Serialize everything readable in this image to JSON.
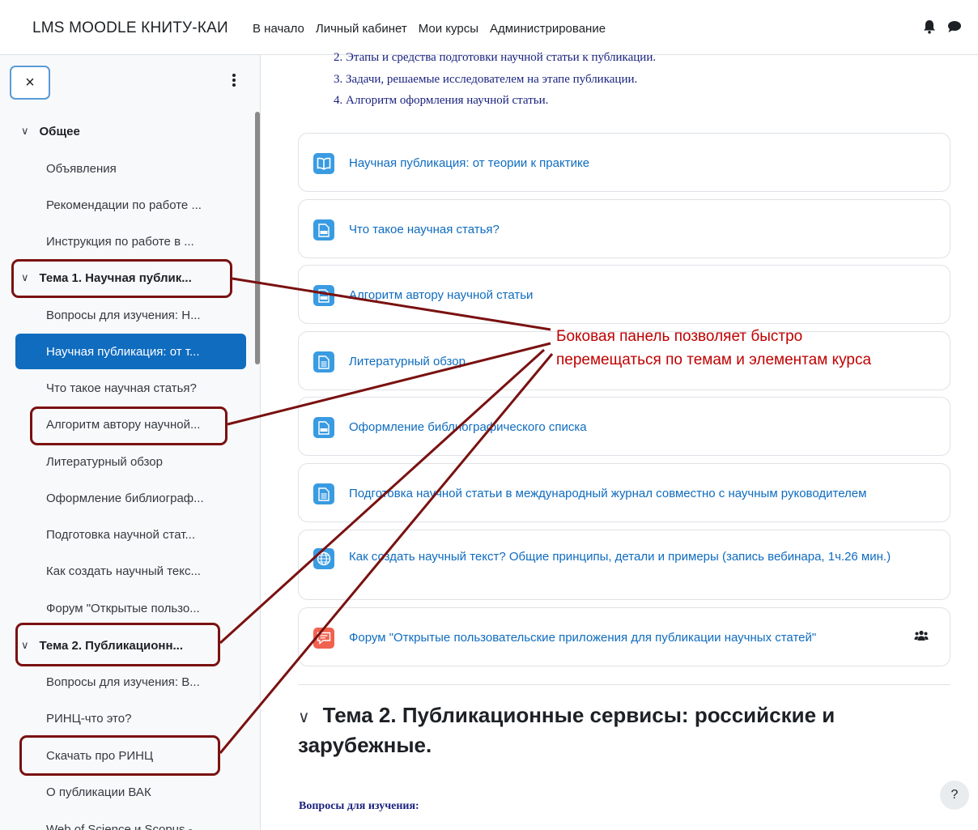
{
  "navbar": {
    "brand": "LMS MOODLE КНИТУ-КАИ",
    "links": [
      "В начало",
      "Личный кабинет",
      "Мои курсы",
      "Администрирование"
    ]
  },
  "sidebar": {
    "close_label": "×",
    "items": [
      {
        "label": "Общее",
        "type": "section"
      },
      {
        "label": "Объявления",
        "type": "activity"
      },
      {
        "label": "Рекомендации по работе ...",
        "type": "activity"
      },
      {
        "label": "Инструкция по работе в ...",
        "type": "activity"
      },
      {
        "label": "Тема 1. Научная публик...",
        "type": "section"
      },
      {
        "label": "Вопросы для изучения:  Н...",
        "type": "activity"
      },
      {
        "label": "Научная публикация: от т...",
        "type": "activity",
        "active": true
      },
      {
        "label": "Что такое научная статья?",
        "type": "activity"
      },
      {
        "label": "Алгоритм автору научной...",
        "type": "activity"
      },
      {
        "label": "Литературный обзор",
        "type": "activity"
      },
      {
        "label": "Оформление библиограф...",
        "type": "activity"
      },
      {
        "label": "Подготовка научной стат...",
        "type": "activity"
      },
      {
        "label": "Как создать научный текс...",
        "type": "activity"
      },
      {
        "label": "Форум \"Открытые пользо...",
        "type": "activity"
      },
      {
        "label": "Тема 2. Публикационн...",
        "type": "section"
      },
      {
        "label": "Вопросы для изучения: В...",
        "type": "activity"
      },
      {
        "label": "РИНЦ-что это?",
        "type": "activity"
      },
      {
        "label": "Скачать про РИНЦ",
        "type": "activity"
      },
      {
        "label": "О публикации ВАК",
        "type": "activity"
      },
      {
        "label": "Web of Science и Scopus -",
        "type": "activity"
      }
    ]
  },
  "main": {
    "list_items": [
      "2. Этапы и средства подготовки научной статьи к публикации.",
      "3. Задачи, решаемые исследователем на этапе публикации.",
      "4. Алгоритм оформления научной статьи."
    ],
    "activities": [
      {
        "title": "Научная публикация: от теории к практике",
        "icon": "book-icon"
      },
      {
        "title": "Что такое научная статья?",
        "icon": "doc-file-icon"
      },
      {
        "title": "Алгоритм автору научной статьи",
        "icon": "pdf-file-icon"
      },
      {
        "title": "Литературный обзор",
        "icon": "page-icon"
      },
      {
        "title": "Оформление библиографического списка",
        "icon": "pdf-file-icon"
      },
      {
        "title": "Подготовка научной статьи в международный журнал совместно с научным руководителем",
        "icon": "page-icon"
      },
      {
        "title": "Как создать научный текст? Общие принципы, детали и примеры (запись вебинара, 1ч.26 мин.)",
        "icon": "globe-icon"
      },
      {
        "title": "Форум \"Открытые пользовательские приложения для публикации научных статей\"",
        "icon": "forum-icon"
      }
    ],
    "section2_title": "Тема 2. Публикационные сервисы: российские и зарубежные.",
    "questions_label": "Вопросы для изучения:",
    "help_label": "?"
  },
  "annotation": {
    "line1": "Боковая панель позволяет быстро",
    "line2": "перемещаться по темам и элементам курса"
  },
  "colors": {
    "primary": "#0f6cbf",
    "annotation": "#c00000",
    "highlight_border": "#7a1111",
    "forum_icon": "#f0624f"
  }
}
